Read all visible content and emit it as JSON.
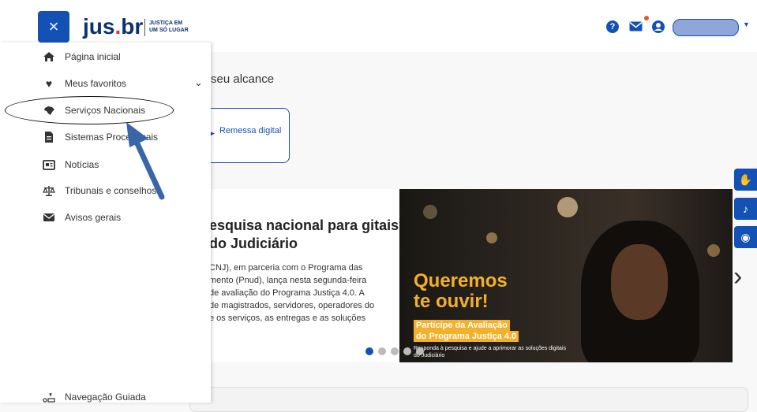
{
  "header": {
    "close_icon": "×",
    "logo_main": "jus",
    "logo_dot": ".",
    "logo_tld": "br",
    "tagline_line1": "JUSTIÇA EM",
    "tagline_line2": "UM SÓ LUGAR",
    "help_icon": "?",
    "icons": [
      "close-icon",
      "help-icon",
      "mail-icon",
      "user-icon",
      "caret-down-icon"
    ]
  },
  "background": {
    "partial_heading": "seu alcance",
    "remessa_label": "Remessa digital",
    "news_title": "esquisa nacional para gitais do Judiciário",
    "news_body_lines": [
      "CNJ), em parceria com o Programa das",
      "mento (Pnud), lança nesta segunda-feira",
      " de avaliação do Programa Justiça 4.0. A",
      "de magistrados, servidores, operadores do",
      "e os serviços, as entregas e as soluções"
    ],
    "banner_title_1": "Queremos",
    "banner_title_2": "te ouvir!",
    "banner_sub_1": "Participe da Avaliação",
    "banner_sub_2": "do Programa Justiça 4.0",
    "banner_small": "Responda à pesquisa e ajude a aprimorar as soluções digitais do Judiciário"
  },
  "menu": {
    "items": [
      {
        "label": "Página inicial",
        "icon": "home-icon"
      },
      {
        "label": "Meus favoritos",
        "icon": "heart-icon"
      },
      {
        "label": "Serviços Nacionais",
        "icon": "brazil-map-icon"
      },
      {
        "label": "Sistemas Processuais",
        "icon": "document-icon"
      },
      {
        "label": "Notícias",
        "icon": "newspaper-icon"
      },
      {
        "label": "Tribunais e conselhos",
        "icon": "scales-icon"
      },
      {
        "label": "Avisos gerais",
        "icon": "envelope-icon"
      }
    ],
    "guided_label": "Navegação Guiada"
  },
  "colors": {
    "brand_blue": "#1351b4",
    "logo_navy": "#0c326f",
    "banner_yellow": "#f3b12b",
    "notification_orange": "#e8562a",
    "annotation_arrow": "#3a66a8"
  }
}
